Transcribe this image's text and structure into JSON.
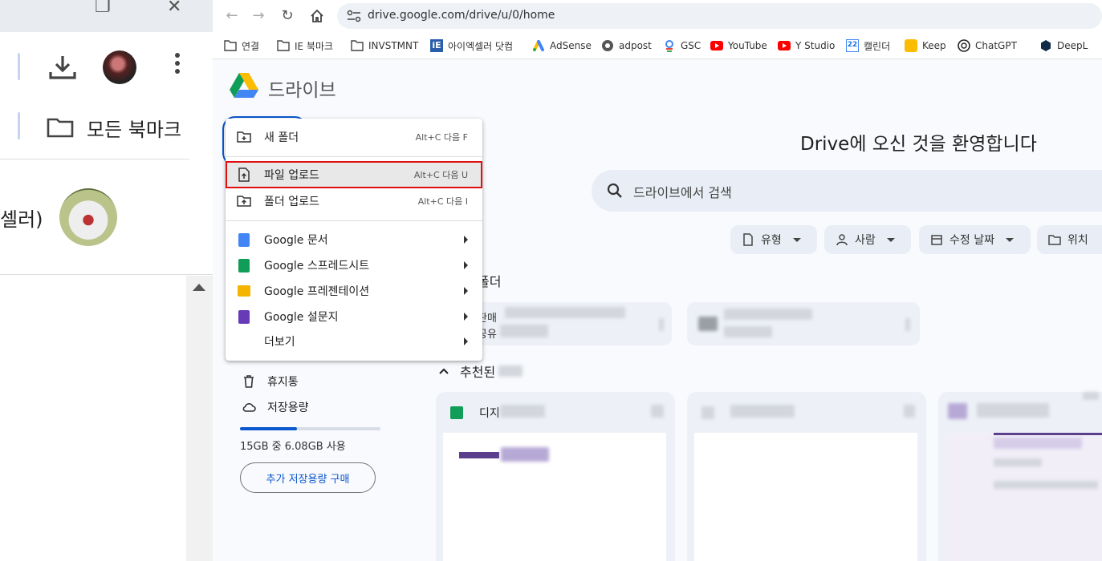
{
  "left_window": {
    "folder_label": "모든 북마크",
    "partial_title": "셀러)"
  },
  "browser": {
    "url": "drive.google.com/drive/u/0/home",
    "bookmarks": [
      {
        "label": "연결",
        "icon": "folder-icon"
      },
      {
        "label": "IE 북마크",
        "icon": "folder-icon"
      },
      {
        "label": "INVSTMNT",
        "icon": "folder-icon"
      },
      {
        "label": "아이엑셀러 닷컴",
        "icon": "ie-icon"
      },
      {
        "label": "AdSense",
        "icon": "adsense-icon"
      },
      {
        "label": "adpost",
        "icon": "adpost-icon"
      },
      {
        "label": "GSC",
        "icon": "gsc-icon"
      },
      {
        "label": "YouTube",
        "icon": "youtube-icon"
      },
      {
        "label": "Y Studio",
        "icon": "youtube-studio-icon"
      },
      {
        "label": "캘린더",
        "icon": "calendar-icon"
      },
      {
        "label": "Keep",
        "icon": "keep-icon"
      },
      {
        "label": "ChatGPT",
        "icon": "chatgpt-icon"
      },
      {
        "label": "DeepL",
        "icon": "deepl-icon"
      }
    ]
  },
  "drive": {
    "app_title": "드라이브",
    "welcome": "Drive에 오신 것을 환영합니다",
    "search_placeholder": "드라이브에서 검색",
    "filters": {
      "type": "유형",
      "people": "사람",
      "modified": "수정 날짜",
      "location": "위치"
    },
    "section_folders": "폴더",
    "folder_card_text": [
      "판매",
      "공유"
    ],
    "section_recommended": "추천된",
    "file_card_name": "디지",
    "sidebar": {
      "trash": "휴지통",
      "storage": "저장용량",
      "storage_text": "15GB 중 6.08GB 사용",
      "storage_fraction": 0.405,
      "buy_storage": "추가 저장용량 구매"
    }
  },
  "menu": {
    "items": [
      {
        "label": "새 폴더",
        "shortcut": "Alt+C 다음 F",
        "icon": "new-folder-icon"
      },
      {
        "label": "파일 업로드",
        "shortcut": "Alt+C 다음 U",
        "icon": "file-upload-icon"
      },
      {
        "label": "폴더 업로드",
        "shortcut": "Alt+C 다음 I",
        "icon": "folder-upload-icon"
      },
      {
        "label": "Google 문서",
        "icon": "google-docs-icon"
      },
      {
        "label": "Google 스프레드시트",
        "icon": "google-sheets-icon"
      },
      {
        "label": "Google 프레젠테이션",
        "icon": "google-slides-icon"
      },
      {
        "label": "Google 설문지",
        "icon": "google-forms-icon"
      },
      {
        "label": "더보기"
      }
    ]
  },
  "colors": {
    "accent": "#0b57d0",
    "highlight_box": "#e01010"
  }
}
